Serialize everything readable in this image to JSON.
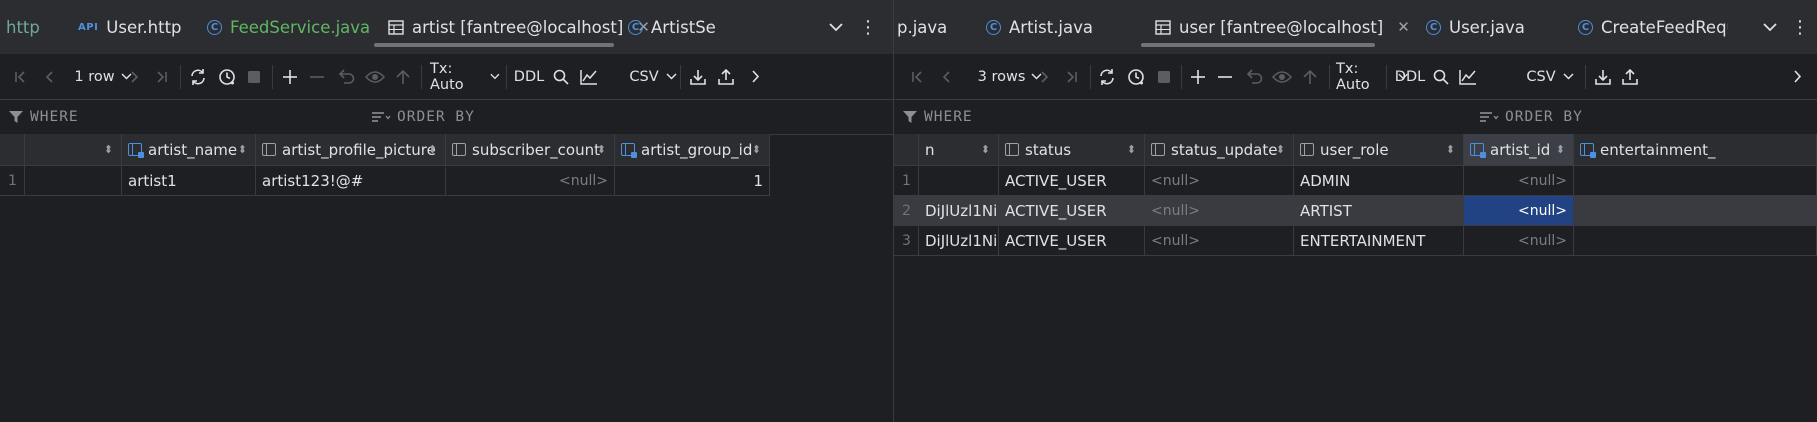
{
  "left": {
    "tabs": [
      {
        "label": "http",
        "icon": "none",
        "style": "teal"
      },
      {
        "label": "User.http",
        "icon": "api-icon",
        "style": "normal"
      },
      {
        "label": "FeedService.java",
        "icon": "class-icon",
        "style": "green"
      },
      {
        "label": "artist [fantree@localhost]",
        "icon": "table-icon",
        "style": "normal",
        "active": true
      },
      {
        "label": "ArtistSe",
        "icon": "class-icon",
        "style": "normal"
      }
    ],
    "toolbar": {
      "rows_label": "1 row",
      "tx_label": "Tx: Auto",
      "ddl_label": "DDL",
      "export_label": "CSV"
    },
    "filter": {
      "where_label": "WHERE",
      "order_label": "ORDER BY"
    },
    "columns": [
      {
        "name": "",
        "icon": "none"
      },
      {
        "name": "artist_name",
        "icon": "fk-column-icon"
      },
      {
        "name": "artist_profile_picture",
        "icon": "column-icon"
      },
      {
        "name": "subscriber_count",
        "icon": "column-icon"
      },
      {
        "name": "artist_group_id",
        "icon": "fk-column-icon"
      }
    ],
    "rows": [
      {
        "num": "1",
        "cells": [
          "",
          "artist1",
          "artist123!@#",
          "<null>",
          "1"
        ]
      }
    ]
  },
  "right": {
    "tabs": [
      {
        "label": "p.java",
        "icon": "none",
        "style": "normal"
      },
      {
        "label": "Artist.java",
        "icon": "class-icon",
        "style": "normal"
      },
      {
        "label": "user [fantree@localhost]",
        "icon": "table-icon",
        "style": "normal",
        "active": true
      },
      {
        "label": "User.java",
        "icon": "class-icon",
        "style": "normal"
      },
      {
        "label": "CreateFeedReque",
        "icon": "class-icon",
        "style": "normal"
      }
    ],
    "toolbar": {
      "rows_label": "3 rows",
      "tx_label": "Tx: Auto",
      "ddl_label": "DDL",
      "export_label": "CSV"
    },
    "filter": {
      "where_label": "WHERE",
      "order_label": "ORDER BY"
    },
    "columns": [
      {
        "name": "n",
        "icon": "none"
      },
      {
        "name": "status",
        "icon": "column-icon"
      },
      {
        "name": "status_update",
        "icon": "column-icon"
      },
      {
        "name": "user_role",
        "icon": "column-icon"
      },
      {
        "name": "artist_id",
        "icon": "fk-column-icon",
        "selected": true
      },
      {
        "name": "entertainment_",
        "icon": "fk-column-icon"
      }
    ],
    "rows": [
      {
        "num": "1",
        "cells": [
          "",
          "ACTIVE_USER",
          "<null>",
          "ADMIN",
          "<null>",
          ""
        ]
      },
      {
        "num": "2",
        "cells": [
          "DiJlUzl1Ni…",
          "ACTIVE_USER",
          "<null>",
          "ARTIST",
          "<null>",
          ""
        ],
        "highlighted": true,
        "selected_cell": 4
      },
      {
        "num": "3",
        "cells": [
          "DiJlUzl1Ni…",
          "ACTIVE_USER",
          "<null>",
          "ENTERTAINMENT",
          "<null>",
          ""
        ]
      }
    ]
  },
  "colors": {
    "background": "#1e1f22",
    "selection": "#214283",
    "accent_blue": "#4f8fe0",
    "green_tab": "#5fb865"
  }
}
